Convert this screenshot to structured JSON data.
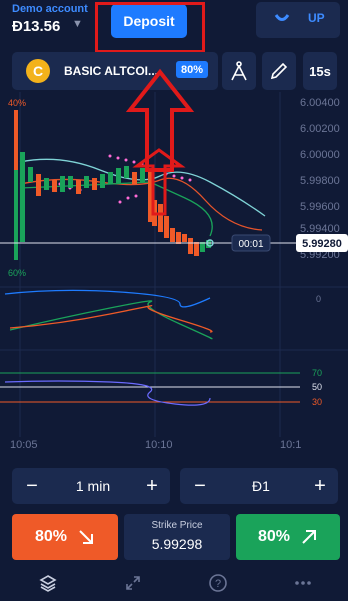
{
  "account": {
    "label": "Demo account",
    "balance": "Đ13.56",
    "dropdown_icon": "chevron-down-icon"
  },
  "header": {
    "deposit_label": "Deposit",
    "down_icon": "arrow-down-icon",
    "up_label": "UP"
  },
  "asset": {
    "icon": "coin-c-icon",
    "coin_letter": "C",
    "name": "BASIC ALTCOI...",
    "payout": "80%"
  },
  "toolbar": {
    "indicators_icon": "compass-icon",
    "draw_icon": "pencil-icon",
    "timeframe": "15s"
  },
  "chart": {
    "price_ticks": [
      "6.00400",
      "6.00200",
      "6.00000",
      "5.99800",
      "5.99600",
      "5.99400",
      "5.99200"
    ],
    "current_price": "5.99280",
    "countdown": "00:01",
    "sentiment_up": "40%",
    "sentiment_down": "60%",
    "macd_zero": "0",
    "rsi_levels": [
      "70",
      "50",
      "30"
    ],
    "time_ticks": [
      "10:05",
      "10:10",
      "10:1"
    ],
    "colors": {
      "up": "#1aa35a",
      "down": "#ef5a28",
      "accent": "#1e7bff"
    }
  },
  "controls": {
    "duration": {
      "minus": "−",
      "value": "1 min",
      "plus": "+"
    },
    "amount": {
      "minus": "−",
      "value": "Đ1",
      "plus": "+"
    }
  },
  "trade": {
    "down_pct": "80%",
    "up_pct": "80%",
    "strike_label": "Strike Price",
    "strike_value": "5.99298"
  },
  "nav": {
    "items": [
      "layers-icon",
      "expand-icon",
      "help-icon",
      "more-icon"
    ]
  }
}
